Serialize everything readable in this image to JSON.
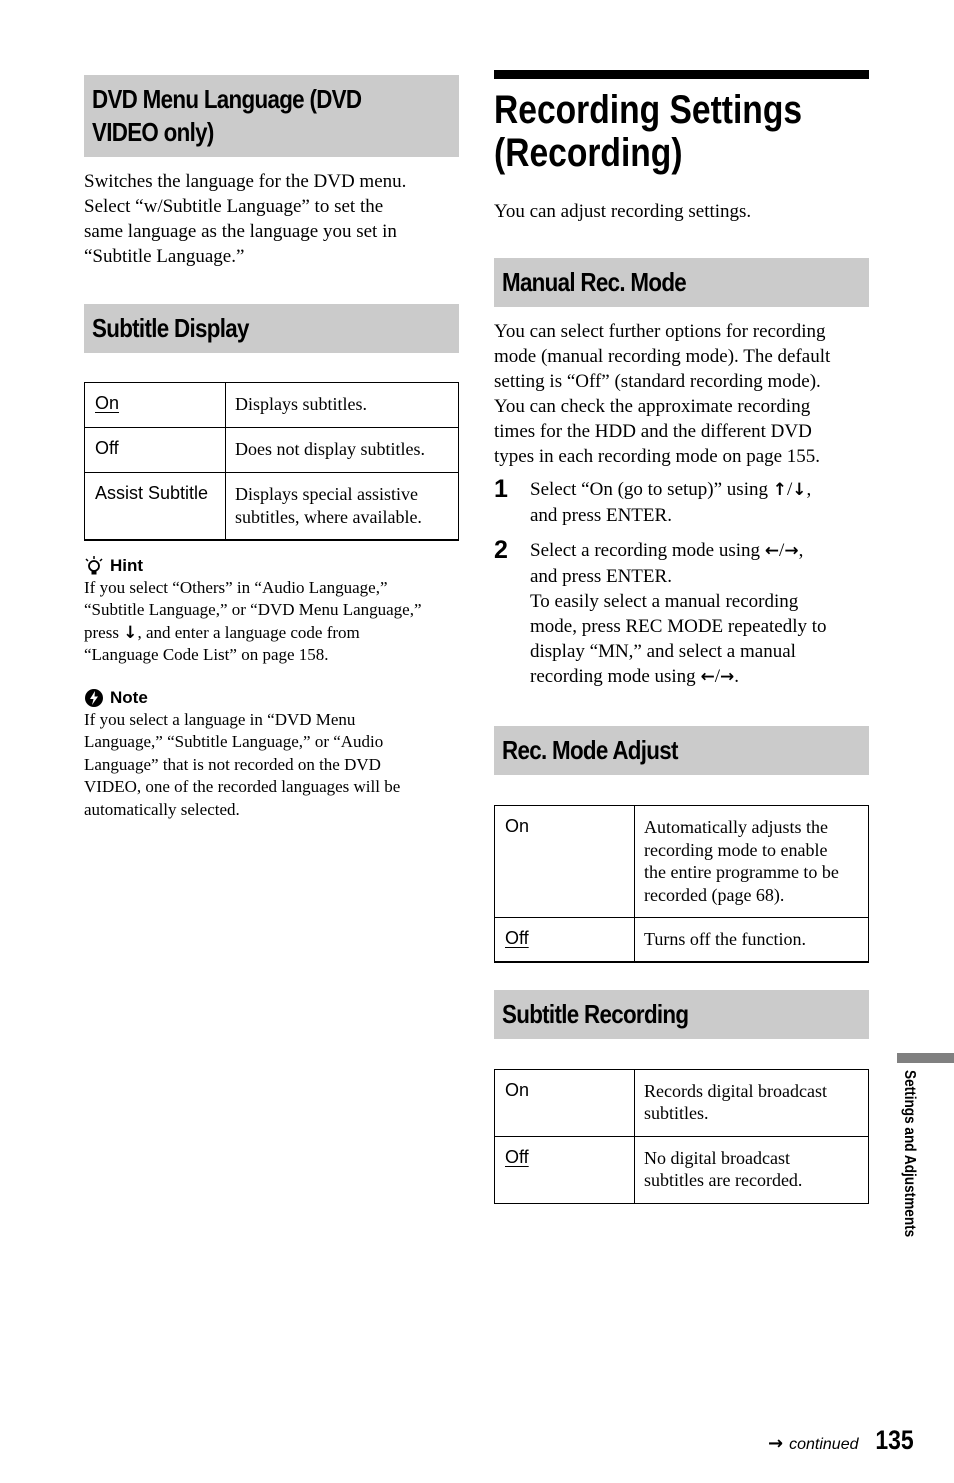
{
  "left": {
    "dvd_menu_language": {
      "heading_lines": [
        "DVD Menu Language (DVD",
        "VIDEO only)"
      ],
      "body_lines": [
        "Switches the language for the DVD menu.",
        "Select “w/Subtitle Language” to set the",
        "same language as the language you set in",
        "“Subtitle Language.”"
      ]
    },
    "subtitle_display": {
      "heading": "Subtitle Display",
      "rows": [
        {
          "option": "On",
          "default": true,
          "description": "Displays subtitles."
        },
        {
          "option": "Off",
          "default": false,
          "description": "Does not display subtitles."
        },
        {
          "option": "Assist Subtitle",
          "default": false,
          "description_lines": [
            "Displays special assistive",
            "subtitles, where available."
          ]
        }
      ]
    },
    "hint": {
      "icon": "lightbulb-icon",
      "label": "Hint",
      "lines": [
        "If you select “Others” in “Audio Language,”",
        "“Subtitle Language,” or “DVD Menu Language,”",
        "press",
        ", and enter a language code from",
        "“Language Code List” on page 158."
      ]
    },
    "note": {
      "icon": "note-icon",
      "label": "Note",
      "lines": [
        "If you select a language in “DVD Menu",
        "Language,” “Subtitle Language,” or “Audio",
        "Language” that is not recorded on the DVD",
        "VIDEO, one of the recorded languages will be",
        "automatically selected."
      ]
    }
  },
  "right": {
    "title_lines": [
      "Recording Settings",
      "(Recording)"
    ],
    "intro": "You can adjust recording settings.",
    "manual_rec_mode": {
      "heading": "Manual Rec. Mode",
      "body_lines": [
        "You can select further options for recording",
        "mode (manual recording mode). The default",
        "setting is “Off” (standard recording mode).",
        "You can check the approximate recording",
        "times for the HDD and the different DVD",
        "types in each recording mode on page 155."
      ],
      "steps": [
        {
          "number": "1",
          "text_a": "Select “On (go to setup)” using ",
          "text_b": ",",
          "text_c": "and press ENTER."
        },
        {
          "number": "2",
          "text_a": "Select a recording mode using ",
          "text_b": ",",
          "text_c": "and press ENTER.",
          "extra_lines": [
            "To easily select a manual recording",
            "mode, press REC MODE repeatedly to",
            "display “MN,” and select a manual",
            "recording mode using "
          ]
        }
      ]
    },
    "rec_mode_adjust": {
      "heading": "Rec. Mode Adjust",
      "rows": [
        {
          "option": "On",
          "default": false,
          "description_lines": [
            "Automatically adjusts the",
            "recording mode to enable",
            "the entire programme to be",
            "recorded (page 68)."
          ]
        },
        {
          "option": "Off",
          "default": true,
          "description": "Turns off the function."
        }
      ]
    },
    "subtitle_recording": {
      "heading": "Subtitle Recording",
      "rows": [
        {
          "option": "On",
          "default": false,
          "description_lines": [
            "Records digital broadcast",
            "subtitles."
          ]
        },
        {
          "option": "Off",
          "default": true,
          "description_lines": [
            "No digital broadcast",
            "subtitles are recorded."
          ]
        }
      ]
    }
  },
  "glyphs": {
    "up": "↑",
    "down": "↓",
    "left": "←",
    "right": "→",
    "slash": "/",
    "period": "."
  },
  "side_tab": {
    "label": "Settings and Adjustments"
  },
  "footer": {
    "continued": "continued",
    "page_number": "135"
  }
}
